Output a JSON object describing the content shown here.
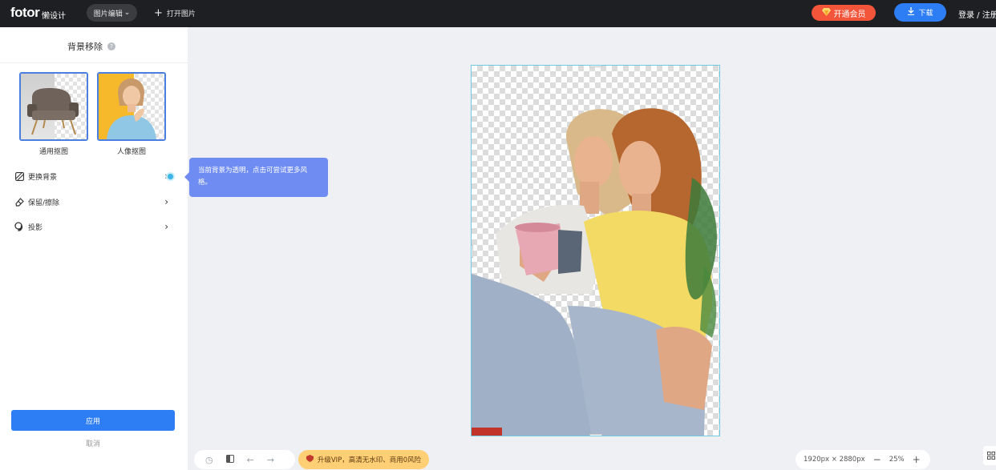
{
  "header": {
    "logo": "fotor",
    "logo_suffix": "懒设计",
    "menu_label": "图片编辑",
    "open_image": "打开图片",
    "vip_button": "开通会员",
    "download_button": "下载",
    "login": "登录 / 注册"
  },
  "sidebar": {
    "title": "背景移除",
    "presets": [
      {
        "label": "通用抠图"
      },
      {
        "label": "人像抠图"
      }
    ],
    "options": [
      {
        "label": "更换背景",
        "icon": "replace-background-icon"
      },
      {
        "label": "保留/擦除",
        "icon": "eraser-icon"
      },
      {
        "label": "投影",
        "icon": "shadow-icon"
      }
    ],
    "apply": "应用",
    "cancel": "取消"
  },
  "tooltip": {
    "text": "当前背景为透明，点击可尝试更多风格。"
  },
  "bottom": {
    "vip_upgrade": "升级VIP，高清无水印、商用0风险",
    "dimensions": "1920px × 2880px",
    "zoom": "25%"
  },
  "colors": {
    "accent": "#2d7ef5",
    "vip": "#f2553a",
    "topbar": "#1e1f22",
    "tooltip": "#6f8cf3"
  }
}
